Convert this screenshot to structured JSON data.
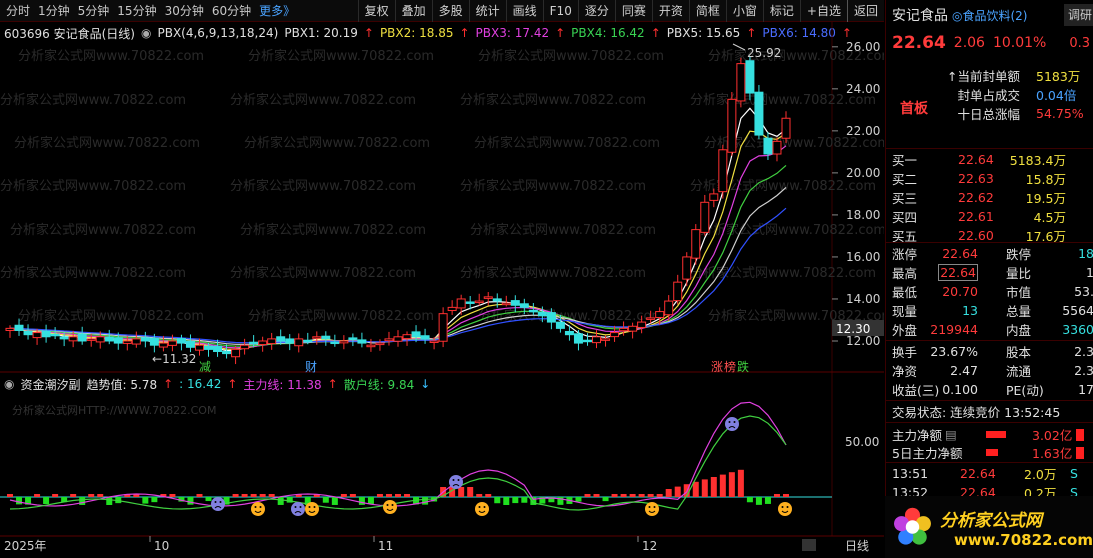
{
  "toolbar": {
    "periods": [
      "分时",
      "1分钟",
      "5分钟",
      "15分钟",
      "30分钟",
      "60分钟"
    ],
    "more": "更多》",
    "buttons": [
      "复权",
      "叠加",
      "多股",
      "统计",
      "画线",
      "F10",
      "逐分",
      "同赛",
      "开资",
      "简框",
      "小窗",
      "标记",
      "+自选",
      "返回"
    ]
  },
  "main_legend": {
    "code_name": "603696 安记食品(日线)",
    "indicator": "PBX(4,6,9,13,18,24)",
    "pbx1": "PBX1: 20.19",
    "pbx2": "PBX2: 18.85",
    "pbx3": "PBX3: 17.42",
    "pbx4": "PBX4: 16.42",
    "pbx5": "PBX5: 15.65",
    "pbx6": "PBX6: 14.80"
  },
  "sub_legend": {
    "name": "资金潮汐副",
    "trend": "趋势值: 5.78",
    "val2": ": 16.42",
    "main_line": "主力线: 11.38",
    "retail_line": "散户线: 9.84"
  },
  "chart_labels": {
    "high": "25.92",
    "low": "11.32",
    "last_price": "12.30",
    "sub_level": "50.00",
    "markers": [
      "减",
      "财",
      "涨",
      "榜",
      "跌"
    ],
    "watermark": "分析家公式网www.70822.com",
    "sub_watermark": "分析家公式网HTTP://WWW.70822.COM"
  },
  "chart_data": {
    "type": "line",
    "ylim": [
      11.0,
      26.8
    ],
    "yticks": [
      12.0,
      14.0,
      16.0,
      18.0,
      20.0,
      22.0,
      24.0,
      26.0
    ],
    "x_labels": [
      "2025年",
      "10",
      "11",
      "12"
    ],
    "period_label": "日线"
  },
  "panel": {
    "name": "安记食品",
    "sector": "◎食品饮料(2)",
    "tab": "调研",
    "price": "22.64",
    "change": "2.06",
    "pct": "10.01%",
    "extra": "0.3",
    "sealing_label": "↑当前封单额",
    "sealing_value": "5183万",
    "seal_ratio_label": "封单占成交",
    "seal_ratio_value": "0.04倍",
    "ten_day_label": "十日总涨幅",
    "ten_day_value": "54.75%",
    "board_tag": "首板",
    "bids": [
      {
        "label": "买一",
        "price": "22.64",
        "vol": "5183.4万"
      },
      {
        "label": "买二",
        "price": "22.63",
        "vol": "15.8万"
      },
      {
        "label": "买三",
        "price": "22.62",
        "vol": "19.5万"
      },
      {
        "label": "买四",
        "price": "22.61",
        "vol": "4.5万"
      },
      {
        "label": "买五",
        "price": "22.60",
        "vol": "17.6万"
      }
    ],
    "stats": [
      {
        "l1": "涨停",
        "v1": "22.64",
        "l2": "跌停",
        "v2": "18"
      },
      {
        "l1": "最高",
        "v1": "22.64",
        "l2": "量比",
        "v2": "1"
      },
      {
        "l1": "最低",
        "v1": "20.70",
        "l2": "市值",
        "v2": "53."
      },
      {
        "l1": "现量",
        "v1": "13",
        "l2": "总量",
        "v2": "5564"
      },
      {
        "l1": "外盘",
        "v1": "219944",
        "l2": "内盘",
        "v2": "3360"
      }
    ],
    "stats2": [
      {
        "l1": "换手",
        "v1": "23.67%",
        "l2": "股本",
        "v2": "2.3"
      },
      {
        "l1": "净资",
        "v1": "2.47",
        "l2": "流通",
        "v2": "2.3"
      },
      {
        "l1": "收益(三)",
        "v1": "0.100",
        "l2": "PE(动)",
        "v2": "17"
      }
    ],
    "trade_status": "交易状态: 连续竞价 13:52:45",
    "net_main_label": "主力净额",
    "net_main_value": "3.02亿",
    "net5_label": "5日主力净额",
    "net5_value": "1.63亿",
    "ticks": [
      {
        "time": "13:51",
        "price": "22.64",
        "vol": "2.0万",
        "side": "S"
      },
      {
        "time": "13:52",
        "price": "22.64",
        "vol": "0.2万",
        "side": "S"
      }
    ],
    "logo_text": "分析家公式网",
    "logo_url": "www.70822.com"
  },
  "colors": {
    "up": "#ff3030",
    "down": "#36e0e0",
    "pbx1": "#ffffff",
    "pbx2": "#f0e040",
    "pbx3": "#e040e0",
    "pbx4": "#40d040",
    "pbx5": "#d0d0d0",
    "pbx6": "#3050ff"
  }
}
